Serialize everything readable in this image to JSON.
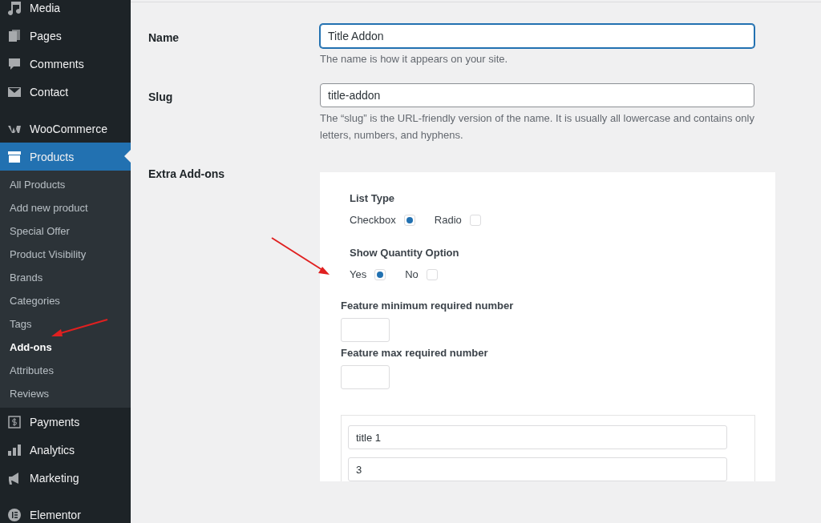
{
  "sidebar": {
    "groups": [
      {
        "items": [
          {
            "label": "Media",
            "selected": false
          },
          {
            "label": "Pages",
            "selected": false
          },
          {
            "label": "Comments",
            "selected": false
          },
          {
            "label": "Contact",
            "selected": false
          }
        ]
      },
      {
        "items": [
          {
            "label": "WooCommerce",
            "selected": false
          },
          {
            "label": "Products",
            "selected": true,
            "children": [
              {
                "label": "All Products",
                "selected": false
              },
              {
                "label": "Add new product",
                "selected": false
              },
              {
                "label": "Special Offer",
                "selected": false
              },
              {
                "label": "Product Visibility",
                "selected": false
              },
              {
                "label": "Brands",
                "selected": false
              },
              {
                "label": "Categories",
                "selected": false
              },
              {
                "label": "Tags",
                "selected": false
              },
              {
                "label": "Add-ons",
                "selected": true
              },
              {
                "label": "Attributes",
                "selected": false
              },
              {
                "label": "Reviews",
                "selected": false
              }
            ]
          },
          {
            "label": "Payments",
            "selected": false
          },
          {
            "label": "Analytics",
            "selected": false
          },
          {
            "label": "Marketing",
            "selected": false
          }
        ]
      },
      {
        "items": [
          {
            "label": "Elementor",
            "selected": false
          }
        ]
      }
    ]
  },
  "form": {
    "name": {
      "label": "Name",
      "value": "Title Addon",
      "focused": true,
      "help": "The name is how it appears on your site."
    },
    "slug": {
      "label": "Slug",
      "value": "title-addon",
      "focused": false,
      "help": "The “slug” is the URL-friendly version of the name. It is usually all lowercase and contains only letters, numbers, and hyphens."
    },
    "extra_addons": {
      "label": "Extra Add-ons",
      "list_type": {
        "label": "List Type",
        "options": [
          {
            "label": "Checkbox",
            "selected": true
          },
          {
            "label": "Radio",
            "selected": false
          }
        ]
      },
      "show_quantity": {
        "label": "Show Quantity Option",
        "options": [
          {
            "label": "Yes",
            "selected": true
          },
          {
            "label": "No",
            "selected": false
          }
        ]
      },
      "min_required": {
        "label": "Feature minimum required number"
      },
      "max_required": {
        "label": "Feature max required number"
      },
      "items": [
        {
          "value": "title 1"
        },
        {
          "value": "3"
        }
      ]
    }
  }
}
